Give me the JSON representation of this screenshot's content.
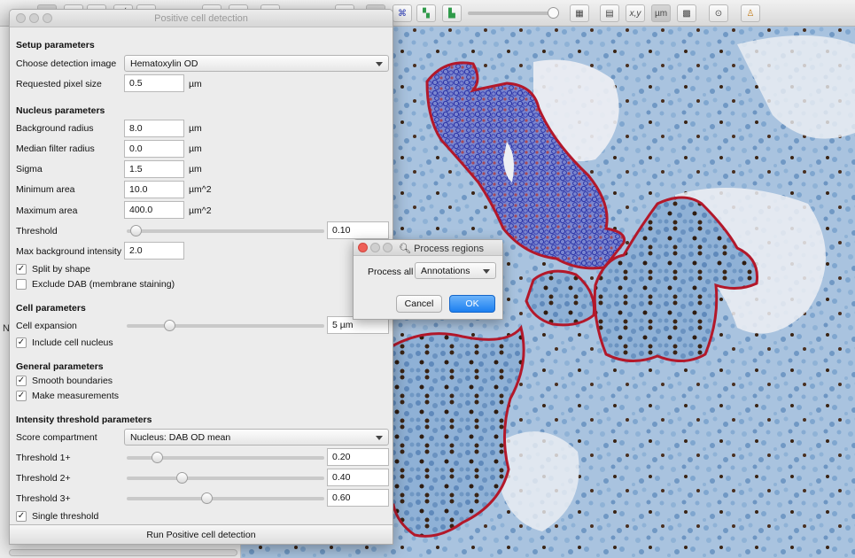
{
  "toolbar": {
    "icons": [
      "move-tool",
      "rectangle-tool",
      "ellipse-tool",
      "line-tool",
      "polygon-tool",
      "brush-tool",
      "wand-tool",
      "points-tool",
      "zoom-to-fit",
      "show-annotations",
      "show-tma-grid",
      "show-detections",
      "fill-detections",
      "show-overview",
      "show-pixel-classification",
      "show-grid",
      "show-coordinates",
      "measurement",
      "counting",
      "settings",
      "log"
    ],
    "coord_label": "x,y",
    "unit_label": "µm",
    "zoom_level": 0.8
  },
  "left_panel": {
    "row_label": "N"
  },
  "pcd": {
    "title": "Positive cell detection",
    "setup_heading": "Setup parameters",
    "detection_image_label": "Choose detection image",
    "detection_image_value": "Hematoxylin OD",
    "pixel_size_label": "Requested pixel size",
    "pixel_size_value": "0.5",
    "pixel_size_unit": "µm",
    "nucleus_heading": "Nucleus parameters",
    "background_radius_label": "Background radius",
    "background_radius_value": "8.0",
    "background_radius_unit": "µm",
    "median_label": "Median filter radius",
    "median_value": "0.0",
    "median_unit": "µm",
    "sigma_label": "Sigma",
    "sigma_value": "1.5",
    "sigma_unit": "µm",
    "min_area_label": "Minimum area",
    "min_area_value": "10.0",
    "min_area_unit": "µm^2",
    "max_area_label": "Maximum area",
    "max_area_value": "400.0",
    "max_area_unit": "µm^2",
    "threshold_label": "Threshold",
    "threshold_value": "0.10",
    "threshold_level": 0.02,
    "max_bg_label": "Max background intensity",
    "max_bg_value": "2.0",
    "split_label": "Split by shape",
    "split_checked": "✓",
    "exclude_label": "Exclude DAB (membrane staining)",
    "cell_heading": "Cell parameters",
    "expansion_label": "Cell expansion",
    "expansion_value": "5 µm",
    "expansion_level": 0.2,
    "include_nucleus_label": "Include cell nucleus",
    "include_nucleus_checked": "✓",
    "general_heading": "General parameters",
    "smooth_label": "Smooth boundaries",
    "smooth_checked": "✓",
    "measure_label": "Make measurements",
    "measure_checked": "✓",
    "intensity_heading": "Intensity threshold parameters",
    "score_label": "Score compartment",
    "score_value": "Nucleus: DAB OD mean",
    "t1_label": "Threshold 1+",
    "t1_value": "0.20",
    "t1_level": 0.133,
    "t2_label": "Threshold 2+",
    "t2_value": "0.40",
    "t2_level": 0.267,
    "t3_label": "Threshold 3+",
    "t3_value": "0.60",
    "t3_level": 0.4,
    "single_label": "Single threshold",
    "single_checked": "✓",
    "run_label": "Run Positive cell detection"
  },
  "process_regions": {
    "title": "Process regions",
    "process_all_label": "Process all",
    "process_all_value": "Annotations",
    "cancel_label": "Cancel",
    "ok_label": "OK"
  },
  "colors": {
    "annotation": "#b3182a",
    "tissue_blue": "#7fa6cf",
    "dab_brown": "#3a2414",
    "detection": "#3a3fb0",
    "ok_button": "#2b86f2"
  }
}
